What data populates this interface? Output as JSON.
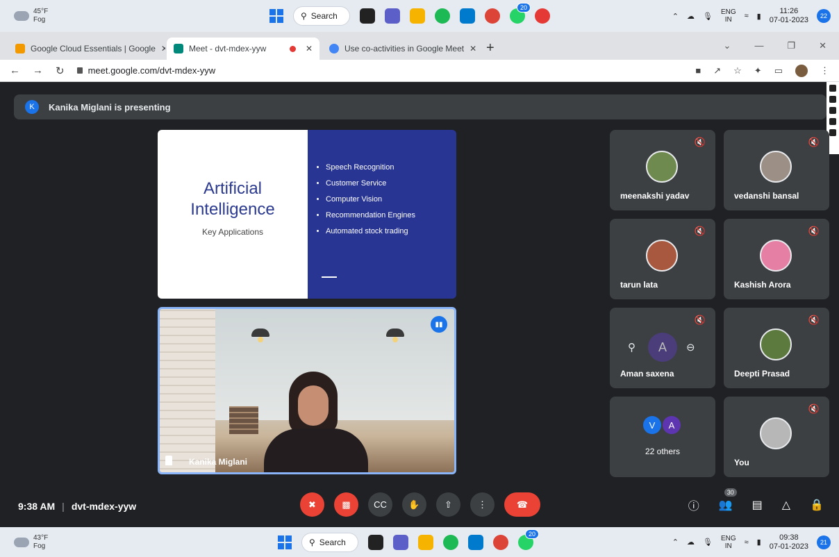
{
  "taskbar_top": {
    "weather_temp": "45°F",
    "weather_cond": "Fog",
    "search_label": "Search",
    "whatsapp_badge": "20",
    "lang_top": "ENG",
    "lang_bottom": "IN",
    "time": "11:26",
    "date": "07-01-2023",
    "notif_count": "22"
  },
  "taskbar_bottom": {
    "weather_temp": "43°F",
    "weather_cond": "Fog",
    "search_label": "Search",
    "whatsapp_badge": "20",
    "lang_top": "ENG",
    "lang_bottom": "IN",
    "time": "09:38",
    "date": "07-01-2023",
    "notif_count": "21"
  },
  "browser": {
    "tabs": [
      {
        "title": "Google Cloud Essentials | Google",
        "favicon_color": "#f29900"
      },
      {
        "title": "Meet - dvt-mdex-yyw",
        "favicon_color": "#00897b"
      },
      {
        "title": "Use co-activities in Google Meet",
        "favicon_color": "#4285f4"
      }
    ],
    "url": "meet.google.com/dvt-mdex-yyw"
  },
  "meet": {
    "presenting_initial": "K",
    "presenting_text": "Kanika Miglani is presenting",
    "slide": {
      "title_line1": "Artificial",
      "title_line2": "Intelligence",
      "subtitle": "Key Applications",
      "bullets": [
        "Speech Recognition",
        "Customer Service",
        "Computer Vision",
        "Recommendation Engines",
        "Automated stock trading"
      ]
    },
    "presenter_name": "Kanika Miglani",
    "participants": [
      {
        "name": "meenakshi yadav",
        "avatar_color": "#6f8a4f"
      },
      {
        "name": "vedanshi bansal",
        "avatar_color": "#9b8f86"
      },
      {
        "name": "tarun lata",
        "avatar_color": "#a8583f"
      },
      {
        "name": "Kashish Arora",
        "avatar_color": "#e57fa4"
      },
      {
        "name": "Aman saxena",
        "initial": "A"
      },
      {
        "name": "Deepti Prasad",
        "avatar_color": "#5c7a3e"
      },
      {
        "others_initials": [
          "V",
          "A"
        ],
        "others_label": "22 others"
      },
      {
        "name": "You",
        "avatar_color": "#b7b7b7"
      }
    ],
    "meeting_time": "9:38 AM",
    "meeting_code": "dvt-mdex-yyw",
    "people_count": "30"
  }
}
